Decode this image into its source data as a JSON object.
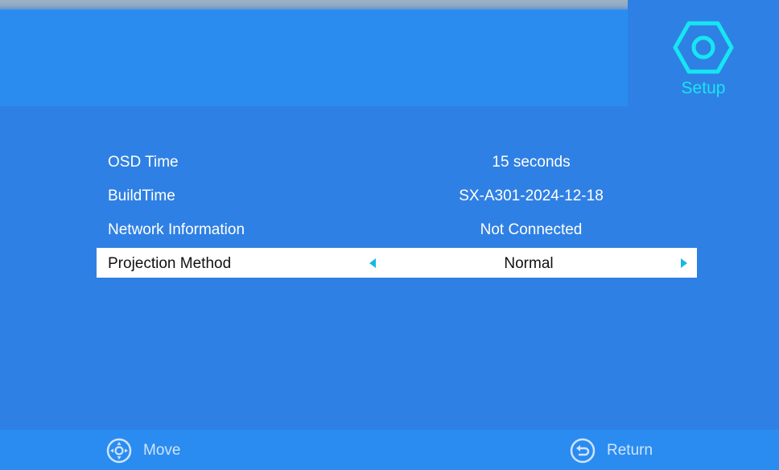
{
  "header": {
    "tab_label": "Setup",
    "tab_icon": "hexagon-settings-icon",
    "accent_color": "#16e6f2"
  },
  "menu": {
    "rows": [
      {
        "label": "OSD Time",
        "value": "15 seconds",
        "selected": false
      },
      {
        "label": "BuildTime",
        "value": "SX-A301-2024-12-18",
        "selected": false
      },
      {
        "label": "Network Information",
        "value": "Not Connected",
        "selected": false
      },
      {
        "label": "Projection Method",
        "value": "Normal",
        "selected": true
      }
    ]
  },
  "footer": {
    "move_label": "Move",
    "move_icon": "dpad-icon",
    "return_label": "Return",
    "return_icon": "return-icon"
  },
  "colors": {
    "background": "#2f80e4",
    "selected_row": "#ffffff",
    "arrow": "#1ab6e8"
  }
}
